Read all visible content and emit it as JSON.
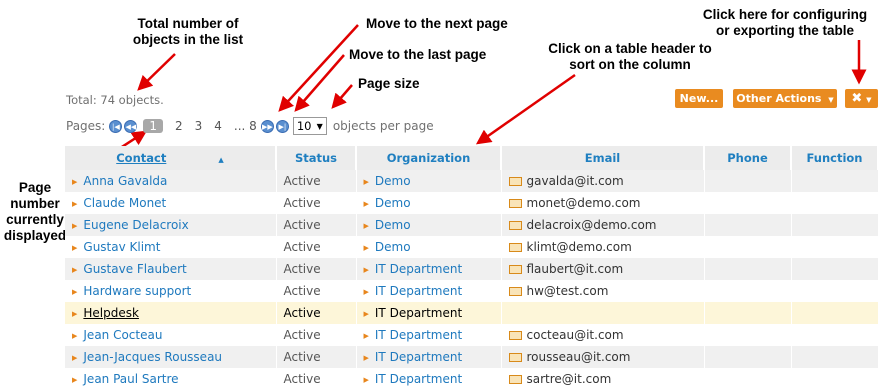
{
  "annotations": {
    "total_count": "Total number of\nobjects in the list",
    "next_page": "Move to the next page",
    "last_page": "Move to the last page",
    "page_size": "Page size",
    "sort": "Click on a table header to\nsort on the column",
    "config": "Click here for configuring\nor exporting the table",
    "current_page": "Page\nnumber\ncurrently\ndisplayed"
  },
  "summary": {
    "total": "Total: 74 objects."
  },
  "pager": {
    "label": "Pages:",
    "current": "1",
    "pages": [
      "2",
      "3",
      "4"
    ],
    "ellipsis": "... 8",
    "page_size": "10",
    "suffix": "objects per page"
  },
  "buttons": {
    "new": "New...",
    "other_actions": "Other Actions",
    "config_icon": "tools-icon"
  },
  "columns": [
    "Contact",
    "Status",
    "Organization",
    "Email",
    "Phone",
    "Function"
  ],
  "rows": [
    {
      "contact": "Anna Gavalda",
      "status": "Active",
      "org": "Demo",
      "email": "gavalda@it.com"
    },
    {
      "contact": "Claude Monet",
      "status": "Active",
      "org": "Demo",
      "email": "monet@demo.com"
    },
    {
      "contact": "Eugene Delacroix",
      "status": "Active",
      "org": "Demo",
      "email": "delacroix@demo.com"
    },
    {
      "contact": "Gustav Klimt",
      "status": "Active",
      "org": "Demo",
      "email": "klimt@demo.com"
    },
    {
      "contact": "Gustave Flaubert",
      "status": "Active",
      "org": "IT Department",
      "email": "flaubert@it.com"
    },
    {
      "contact": "Hardware support",
      "status": "Active",
      "org": "IT Department",
      "email": "hw@test.com"
    },
    {
      "contact": "Helpdesk",
      "status": "Active",
      "org": "IT Department",
      "email": ""
    },
    {
      "contact": "Jean Cocteau",
      "status": "Active",
      "org": "IT Department",
      "email": "cocteau@it.com"
    },
    {
      "contact": "Jean-Jacques Rousseau",
      "status": "Active",
      "org": "IT Department",
      "email": "rousseau@it.com"
    },
    {
      "contact": "Jean Paul Sartre",
      "status": "Active",
      "org": "IT Department",
      "email": "sartre@it.com"
    }
  ]
}
